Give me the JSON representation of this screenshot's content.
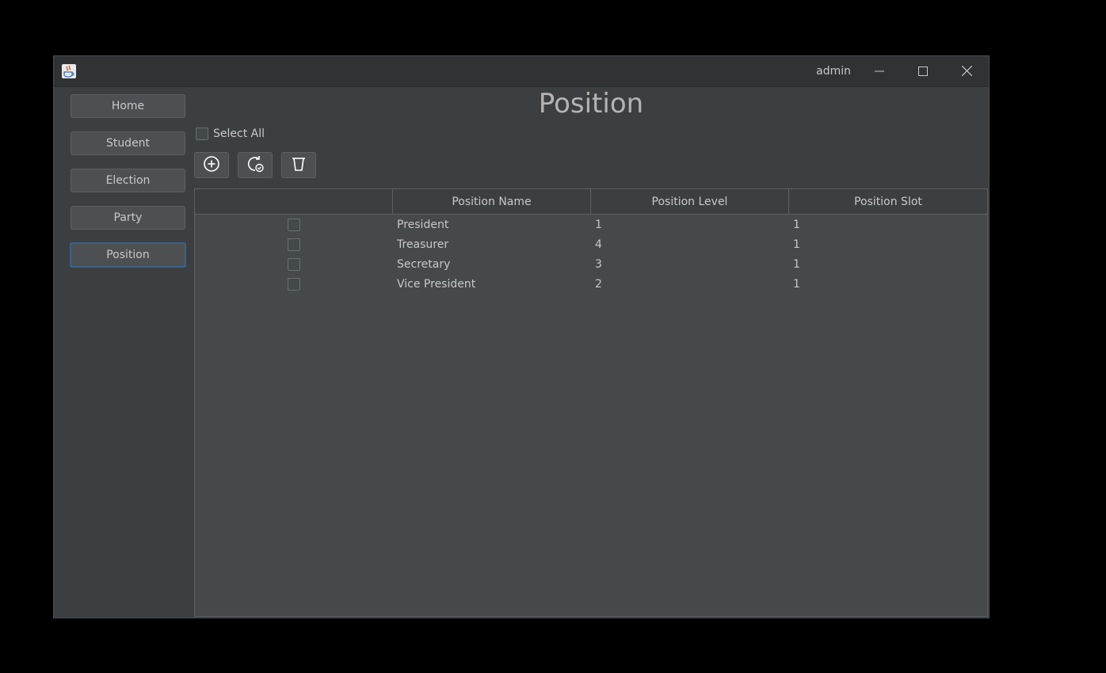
{
  "window": {
    "user": "admin",
    "controls": [
      "minimize-icon",
      "maximize-icon",
      "close-icon"
    ]
  },
  "sidebar": {
    "items": [
      {
        "label": "Home",
        "active": false
      },
      {
        "label": "Student",
        "active": false
      },
      {
        "label": "Election",
        "active": false
      },
      {
        "label": "Party",
        "active": false
      },
      {
        "label": "Position",
        "active": true
      }
    ]
  },
  "page": {
    "title": "Position",
    "select_all_label": "Select All"
  },
  "toolbar": {
    "icons": [
      "add-circle-icon",
      "refresh-check-icon",
      "delete-bin-icon"
    ]
  },
  "table": {
    "columns": [
      "",
      "Position Name",
      "Position Level",
      "Position Slot"
    ],
    "rows": [
      {
        "checked": false,
        "name": "President",
        "level": "1",
        "slot": "1"
      },
      {
        "checked": false,
        "name": "Treasurer",
        "level": "4",
        "slot": "1"
      },
      {
        "checked": false,
        "name": "Secretary",
        "level": "3",
        "slot": "1"
      },
      {
        "checked": false,
        "name": "Vice President",
        "level": "2",
        "slot": "1"
      }
    ]
  },
  "colors": {
    "background": "#3c3f41",
    "panel": "#45494a",
    "text": "#c8c8c8",
    "active_border": "#3d6185"
  }
}
